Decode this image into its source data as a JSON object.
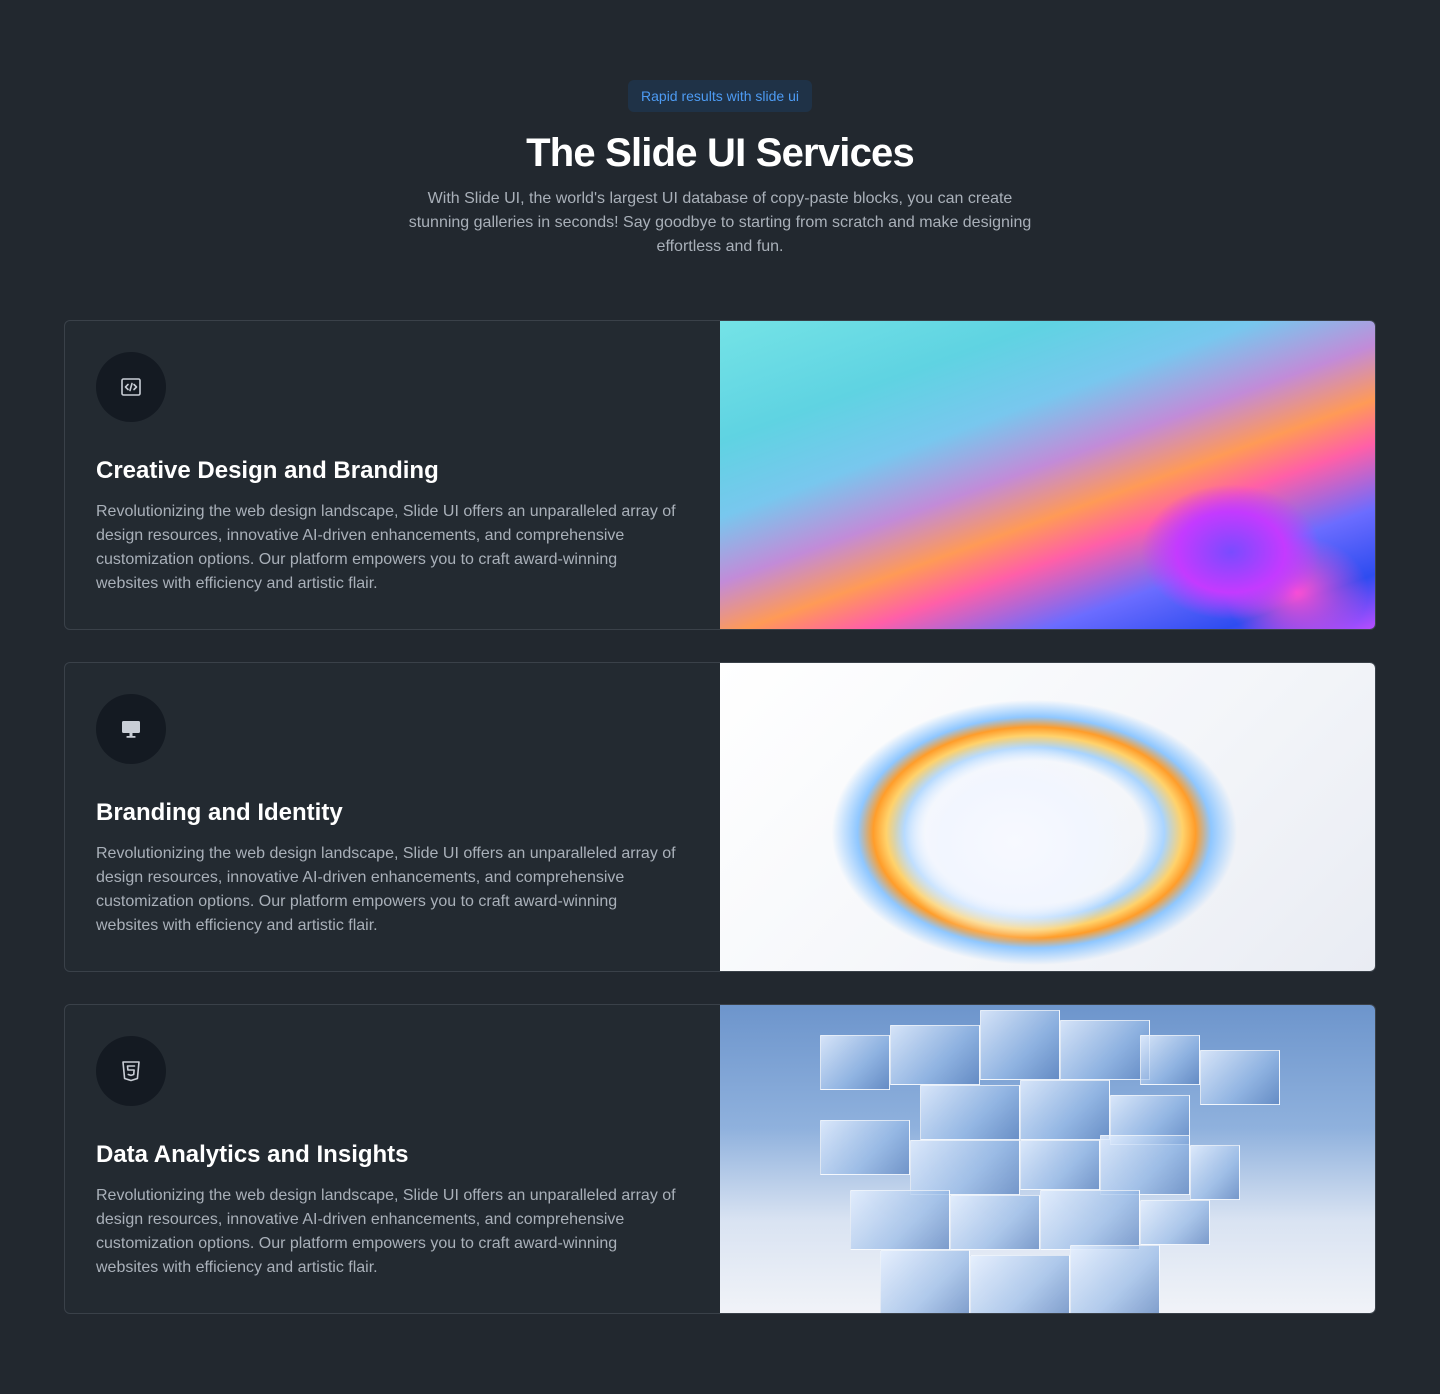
{
  "header": {
    "badge": "Rapid results with slide ui",
    "title": "The Slide UI Services",
    "subtitle": "With Slide UI, the world's largest UI database of copy-paste blocks, you can create stunning galleries in seconds! Say goodbye to starting from scratch and make designing effortless and fun."
  },
  "services": [
    {
      "icon": "code-icon",
      "title": "Creative Design and Branding",
      "description": "Revolutionizing the web design landscape, Slide UI offers an unparalleled array of design resources, innovative AI-driven enhancements, and comprehensive customization options. Our platform empowers you to craft award-winning websites with efficiency and artistic flair."
    },
    {
      "icon": "monitor-icon",
      "title": "Branding and Identity",
      "description": "Revolutionizing the web design landscape, Slide UI offers an unparalleled array of design resources, innovative AI-driven enhancements, and comprehensive customization options. Our platform empowers you to craft award-winning websites with efficiency and artistic flair."
    },
    {
      "icon": "html5-icon",
      "title": "Data Analytics and Insights",
      "description": "Revolutionizing the web design landscape, Slide UI offers an unparalleled array of design resources, innovative AI-driven enhancements, and comprehensive customization options. Our platform empowers you to craft award-winning websites with efficiency and artistic flair."
    }
  ],
  "colors": {
    "background": "#22282f",
    "badge_text": "#4d9bf3",
    "badge_bg": "#1f3247",
    "card_border": "#3a4149",
    "muted_text": "#a9b0b9",
    "icon_circle": "#141a22"
  }
}
